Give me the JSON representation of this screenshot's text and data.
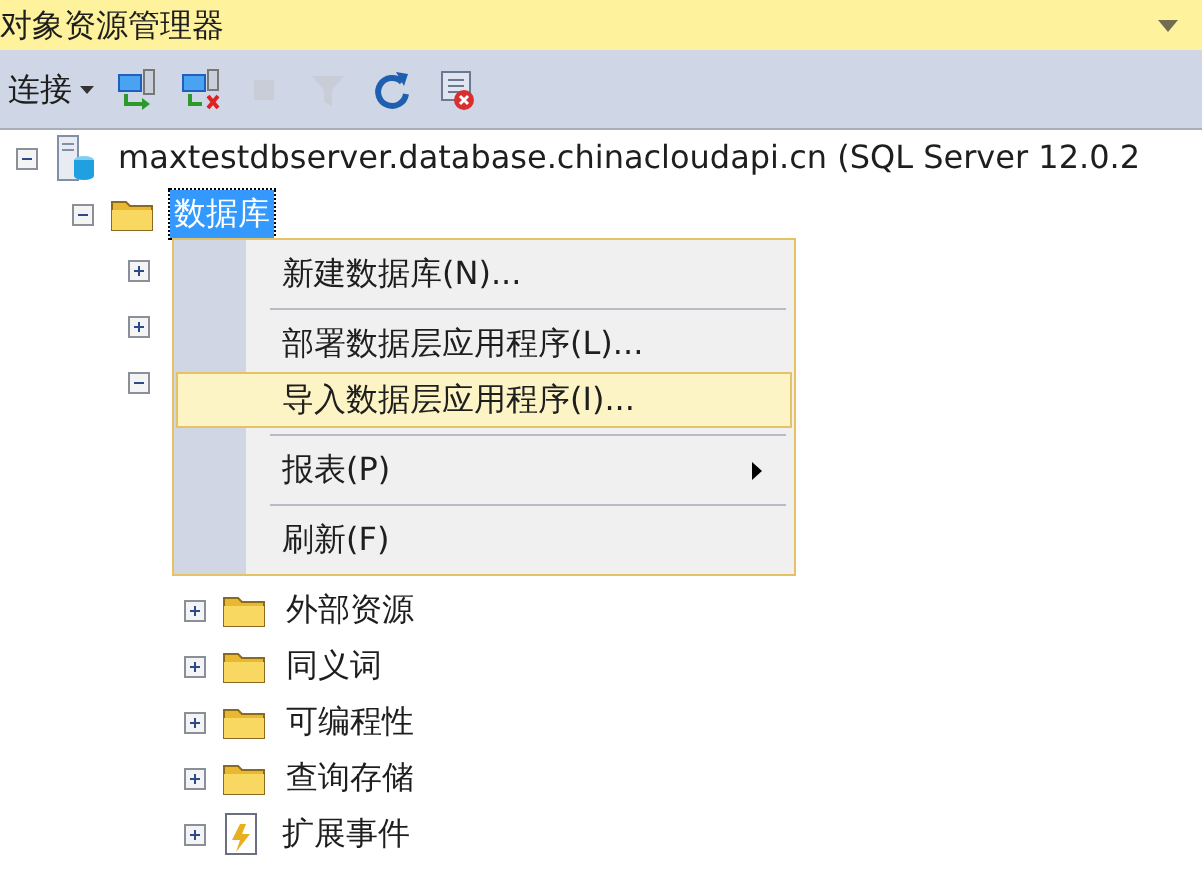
{
  "panel": {
    "title": "对象资源管理器"
  },
  "toolbar": {
    "connect_label": "连接",
    "buttons": [
      {
        "kind": "connect",
        "disabled": false
      },
      {
        "kind": "disconnect",
        "disabled": false
      },
      {
        "kind": "stop",
        "disabled": true
      },
      {
        "kind": "filter",
        "disabled": true
      },
      {
        "kind": "refresh",
        "disabled": false
      },
      {
        "kind": "script",
        "disabled": false
      }
    ]
  },
  "tree": [
    {
      "label": "maxtestdbserver.database.chinacloudapi.cn (SQL Server 12.0.2",
      "kind": "server",
      "expanded": true,
      "children": [
        {
          "label": "数据库",
          "kind": "folder",
          "expanded": true,
          "selected": true,
          "children": [
            {
              "expanded": false
            },
            {
              "expanded": false
            },
            {
              "expanded": true,
              "children": [
                {
                  "label": "外部资源",
                  "kind": "folder",
                  "expanded": false,
                  "selected": false
                },
                {
                  "label": "同义词",
                  "kind": "folder",
                  "expanded": false,
                  "selected": false
                },
                {
                  "label": "可编程性",
                  "kind": "folder",
                  "expanded": false,
                  "selected": false
                },
                {
                  "label": "查询存储",
                  "kind": "folder",
                  "expanded": false,
                  "selected": false
                },
                {
                  "label": "扩展事件",
                  "kind": "events",
                  "expanded": false,
                  "selected": false
                }
              ]
            }
          ]
        }
      ]
    }
  ],
  "context_menu": {
    "items": [
      {
        "kind": "item",
        "label": "新建数据库(N)...",
        "selected": false
      },
      {
        "kind": "separator"
      },
      {
        "kind": "item",
        "label": "部署数据层应用程序(L)...",
        "selected": false
      },
      {
        "kind": "item",
        "label": "导入数据层应用程序(I)...",
        "selected": true
      },
      {
        "kind": "separator"
      },
      {
        "kind": "submenu",
        "label": "报表(P)",
        "selected": false
      },
      {
        "kind": "separator"
      },
      {
        "kind": "item",
        "label": "刷新(F)",
        "selected": false
      }
    ]
  }
}
